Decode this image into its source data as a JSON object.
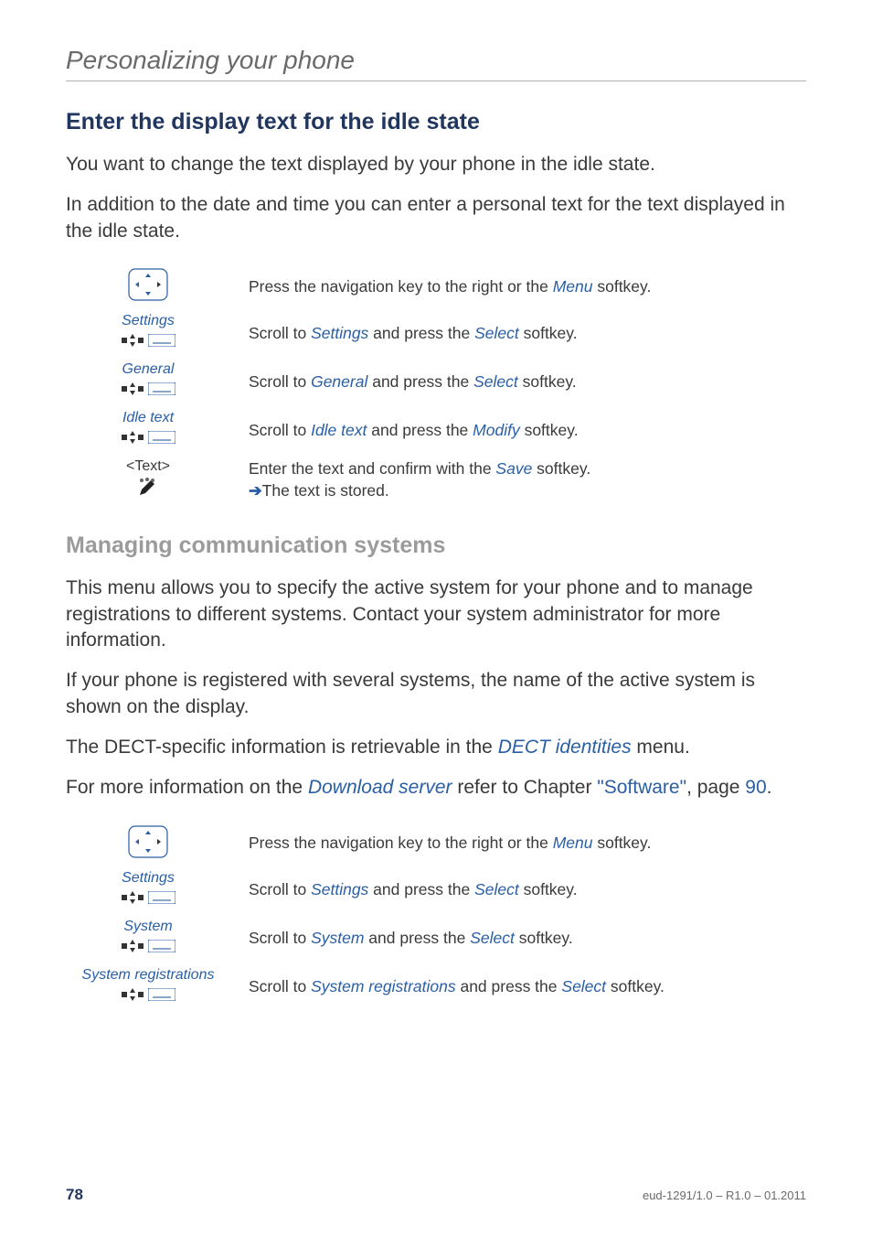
{
  "chapter": "Personalizing your phone",
  "section1": {
    "title": "Enter the display text for the idle state",
    "para1": "You want to change the text displayed by your phone in the idle state.",
    "para2": "In addition to the date and time you can enter a personal text for the text displayed in the idle state."
  },
  "steps1": {
    "nav": {
      "pre": "Press the navigation key to the right or the ",
      "kw": "Menu",
      "post": " softkey."
    },
    "settings": {
      "label": "Settings",
      "pre": "Scroll to ",
      "kw1": "Settings",
      "mid": " and press the ",
      "kw2": "Select",
      "post": " softkey."
    },
    "general": {
      "label": "General",
      "pre": "Scroll to ",
      "kw1": "General",
      "mid": " and press the ",
      "kw2": "Select",
      "post": " softkey."
    },
    "idletext": {
      "label": "Idle text",
      "pre": "Scroll to ",
      "kw1": "Idle text",
      "mid": " and press the ",
      "kw2": "Modify",
      "post": " softkey."
    },
    "entry": {
      "label": "<Text>",
      "line1pre": "Enter the text and confirm with the ",
      "kw": "Save",
      "line1post": " softkey.",
      "line2": "The text is stored."
    }
  },
  "section2": {
    "title": "Managing communication systems",
    "para1": "This menu allows you to specify the active system for your phone and to manage registrations to different systems. Contact your system administrator for more information.",
    "para2": "If your phone is registered with several systems, the name of the active system is shown on the display.",
    "para3": {
      "pre": "The DECT-specific information is retrievable in the ",
      "kw": "DECT identities",
      "post": " menu."
    },
    "para4": {
      "pre": "For more information on the ",
      "kw": "Download server",
      "mid": " refer to Chapter ",
      "link": "\"Software\"",
      "mid2": ", page ",
      "page": "90",
      "post": "."
    }
  },
  "steps2": {
    "nav": {
      "pre": "Press the navigation key to the right or the ",
      "kw": "Menu",
      "post": " softkey."
    },
    "settings": {
      "label": "Settings",
      "pre": "Scroll to ",
      "kw1": "Settings",
      "mid": " and press the ",
      "kw2": "Select",
      "post": " softkey."
    },
    "system": {
      "label": "System",
      "pre": "Scroll to ",
      "kw1": "System",
      "mid": " and press the ",
      "kw2": "Select",
      "post": " softkey."
    },
    "sysreg": {
      "label": "System registrations",
      "pre": "Scroll to ",
      "kw1": "System registrations",
      "mid": " and press the ",
      "kw2": "Select",
      "post": " softkey."
    }
  },
  "footer": {
    "page": "78",
    "docid": "eud-1291/1.0 – R1.0 – 01.2011"
  }
}
